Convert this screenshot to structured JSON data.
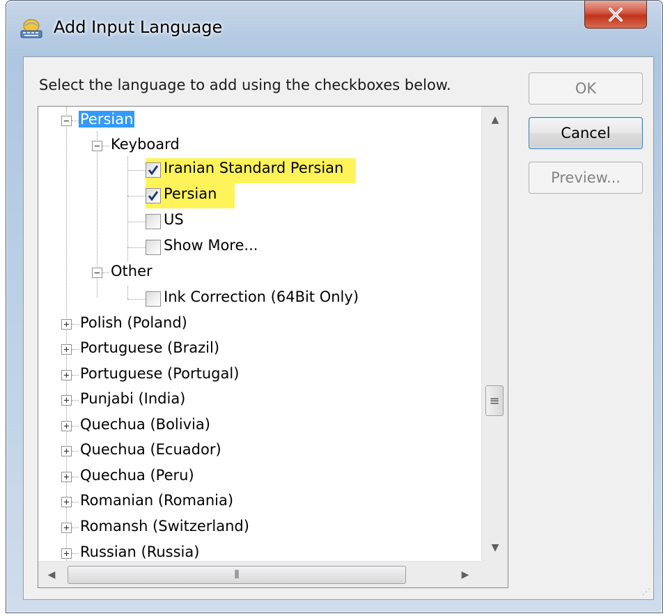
{
  "window": {
    "title": "Add Input Language",
    "close_icon": "close-icon"
  },
  "instruction": "Select the language to add using the checkboxes below.",
  "buttons": {
    "ok": "OK",
    "cancel": "Cancel",
    "preview": "Preview..."
  },
  "tree": {
    "expanded_language": "Persian",
    "group_keyboard": "Keyboard",
    "keyboard_items": [
      {
        "label": "Iranian Standard Persian",
        "checked": true,
        "highlighted": true
      },
      {
        "label": "Persian",
        "checked": true,
        "highlighted": true
      },
      {
        "label": "US",
        "checked": false
      },
      {
        "label": "Show More...",
        "checked": false
      }
    ],
    "group_other": "Other",
    "other_items": [
      {
        "label": "Ink Correction (64Bit Only)",
        "checked": false
      }
    ],
    "languages": [
      "Polish (Poland)",
      "Portuguese (Brazil)",
      "Portuguese (Portugal)",
      "Punjabi (India)",
      "Quechua (Bolivia)",
      "Quechua (Ecuador)",
      "Quechua (Peru)",
      "Romanian (Romania)",
      "Romansh (Switzerland)",
      "Russian (Russia)"
    ]
  },
  "colors": {
    "selection": "#3399ff",
    "highlight": "#fff35a",
    "close_button": "#c0331c"
  }
}
